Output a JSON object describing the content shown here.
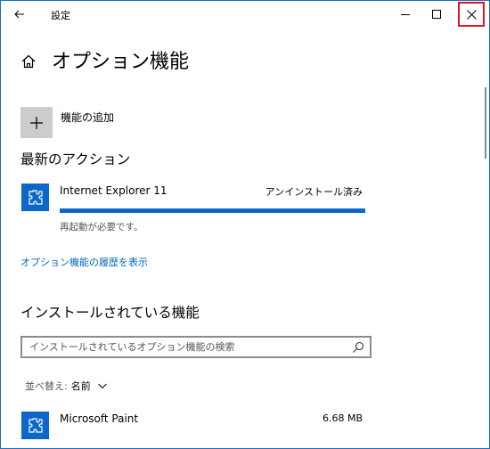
{
  "window": {
    "title": "設定",
    "back_icon": "back-arrow-icon",
    "minimize_icon": "minimize-icon",
    "maximize_icon": "maximize-icon",
    "close_icon": "close-icon"
  },
  "header": {
    "title": "オプション機能",
    "home_icon": "home-icon"
  },
  "add_feature": {
    "label": "機能の追加",
    "icon": "plus-icon"
  },
  "recent": {
    "section_title": "最新のアクション",
    "item": {
      "name": "Internet Explorer 11",
      "status": "アンインストール済み",
      "note": "再起動が必要です。",
      "progress": 1.0,
      "icon": "puzzle-icon"
    }
  },
  "history_link": "オプション機能の履歴を表示",
  "installed": {
    "section_title": "インストールされている機能",
    "search_placeholder": "インストールされているオプション機能の検索",
    "sort_label": "並べ替え:",
    "sort_value": "名前",
    "items": [
      {
        "name": "Microsoft Paint",
        "size": "6.68 MB",
        "icon": "puzzle-icon"
      }
    ]
  },
  "colors": {
    "accent": "#0c67c8",
    "link": "#0067c0",
    "close_highlight": "#e0141e"
  }
}
